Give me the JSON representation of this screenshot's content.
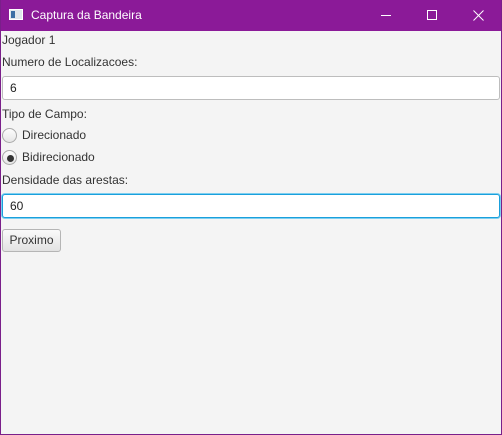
{
  "window": {
    "title": "Captura da Bandeira",
    "accent_color": "#8b1a98",
    "controls": [
      "minimize-icon",
      "maximize-icon",
      "close-icon"
    ]
  },
  "form": {
    "player_label": "Jogador 1",
    "locations_label": "Numero de Localizacoes:",
    "locations_value": "6",
    "field_type_label": "Tipo de Campo:",
    "radio_options": [
      {
        "label": "Direcionado",
        "selected": false
      },
      {
        "label": "Bidirecionado",
        "selected": true
      }
    ],
    "density_label": "Densidade das arestas:",
    "density_value": "60",
    "next_button": "Proximo"
  }
}
